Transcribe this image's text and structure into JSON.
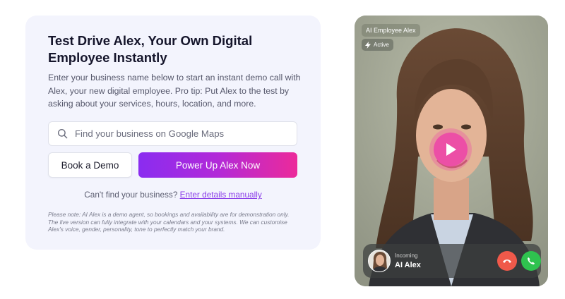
{
  "demo": {
    "title": "Test Drive Alex, Your Own Digital Employee Instantly",
    "description": "Enter your business name below to start an instant demo call with Alex, your new digital employee. Pro tip: Put Alex to the test by asking about your services, hours, location, and more.",
    "search": {
      "placeholder": "Find your business on Google Maps",
      "icon": "search-icon"
    },
    "book_demo_label": "Book a Demo",
    "power_up_label": "Power Up Alex Now",
    "cant_find_text": "Can't find your business?",
    "enter_manually_link": "Enter details manually",
    "note": "Please note: AI Alex is a demo agent, so bookings and availability are for demonstration only. The live version can fully integrate with your calendars and your systems. We can customise Alex's voice, gender, personality, tone to perfectly match your brand."
  },
  "video": {
    "employee_label": "AI Employee Alex",
    "status_label": "Active",
    "call": {
      "status": "Incoming",
      "caller": "AI Alex"
    }
  },
  "colors": {
    "accent_purple": "#8a2cf0",
    "accent_pink": "#ec2a9a",
    "link": "#8a3ee8",
    "decline": "#f0594a",
    "accept": "#2fc24f",
    "card_bg": "#f3f4fd"
  }
}
